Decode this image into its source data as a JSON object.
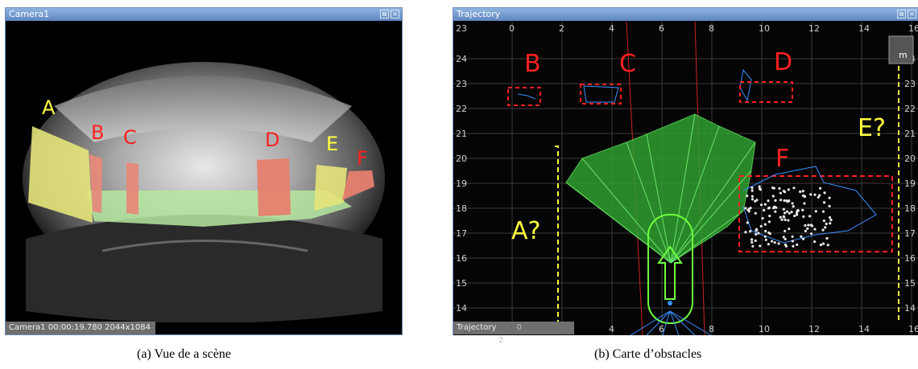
{
  "camera_window": {
    "title": "Camera1",
    "status": "Camera1  00:00:19.780  2044x1084",
    "labels": [
      "A",
      "B",
      "C",
      "D",
      "E",
      "F"
    ]
  },
  "trajectory_window": {
    "title": "Trajectory",
    "tab_label": "Trajectory",
    "unit_label": "m",
    "x_ticks": [
      "0",
      "2",
      "4",
      "6",
      "8",
      "10",
      "12",
      "14",
      "16"
    ],
    "y_ticks": [
      "24",
      "23",
      "22",
      "21",
      "20",
      "19",
      "18",
      "17",
      "16",
      "15",
      "14"
    ],
    "corner_label": "23",
    "bottom_x_labels": [
      "0",
      "2"
    ],
    "labels_red": [
      "B",
      "C",
      "D",
      "F"
    ],
    "labels_yellow": [
      "A?",
      "E?"
    ]
  },
  "captions": {
    "a": "(a) Vue de a scène",
    "b": "(b) Carte d’obstacles"
  },
  "colors": {
    "red": "#ff2020",
    "yellow": "#ffff40",
    "green": "#3fbf3f",
    "blue": "#3a8fff",
    "titlebar": "#6f97cc"
  }
}
